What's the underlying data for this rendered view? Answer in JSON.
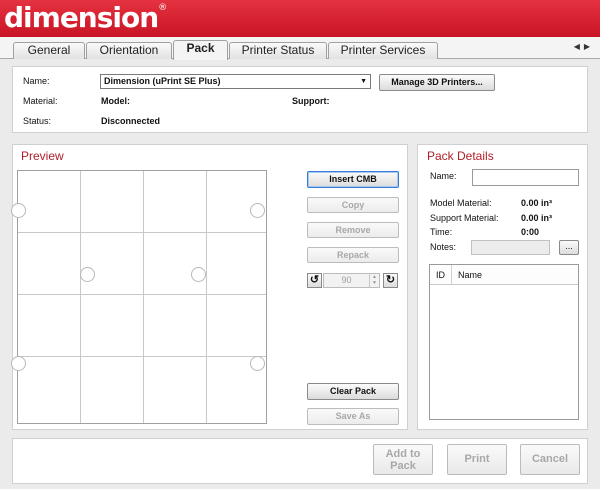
{
  "app": {
    "logo_text": "dimension",
    "logo_mark": "®"
  },
  "tabs": [
    {
      "label": "General"
    },
    {
      "label": "Orientation"
    },
    {
      "label": "Pack",
      "active": true
    },
    {
      "label": "Printer Status"
    },
    {
      "label": "Printer Services"
    }
  ],
  "tab_scroll": {
    "left_icon": "triangle-left-icon",
    "right_icon": "triangle-right-icon"
  },
  "printer": {
    "name_label": "Name:",
    "name_value": "Dimension  (uPrint SE Plus)",
    "manage_button": "Manage 3D Printers...",
    "material_label": "Material:",
    "model_label": "Model:",
    "support_label": "Support:",
    "status_label": "Status:",
    "status_value": "Disconnected"
  },
  "preview": {
    "title": "Preview",
    "grid": {
      "columns": 4,
      "rows": 4
    }
  },
  "actions": {
    "insert_cmb": "Insert CMB",
    "copy": "Copy",
    "remove": "Remove",
    "repack": "Repack",
    "rotation_value": "90",
    "clear_pack": "Clear Pack",
    "save_as": "Save As"
  },
  "pack_details": {
    "title": "Pack Details",
    "name_label": "Name:",
    "name_value": "",
    "model_material_label": "Model Material:",
    "model_material_value": "0.00 in³",
    "support_material_label": "Support Material:",
    "support_material_value": "0.00 in³",
    "time_label": "Time:",
    "time_value": "0:00",
    "notes_label": "Notes:",
    "notes_button": "...",
    "columns": [
      "ID",
      "Name"
    ]
  },
  "footer": {
    "add_to_pack": "Add to Pack",
    "print": "Print",
    "cancel": "Cancel"
  },
  "colors": {
    "banner": "#d21f2e",
    "section_title": "#b0202a",
    "focus_border": "#3a7bd5"
  }
}
